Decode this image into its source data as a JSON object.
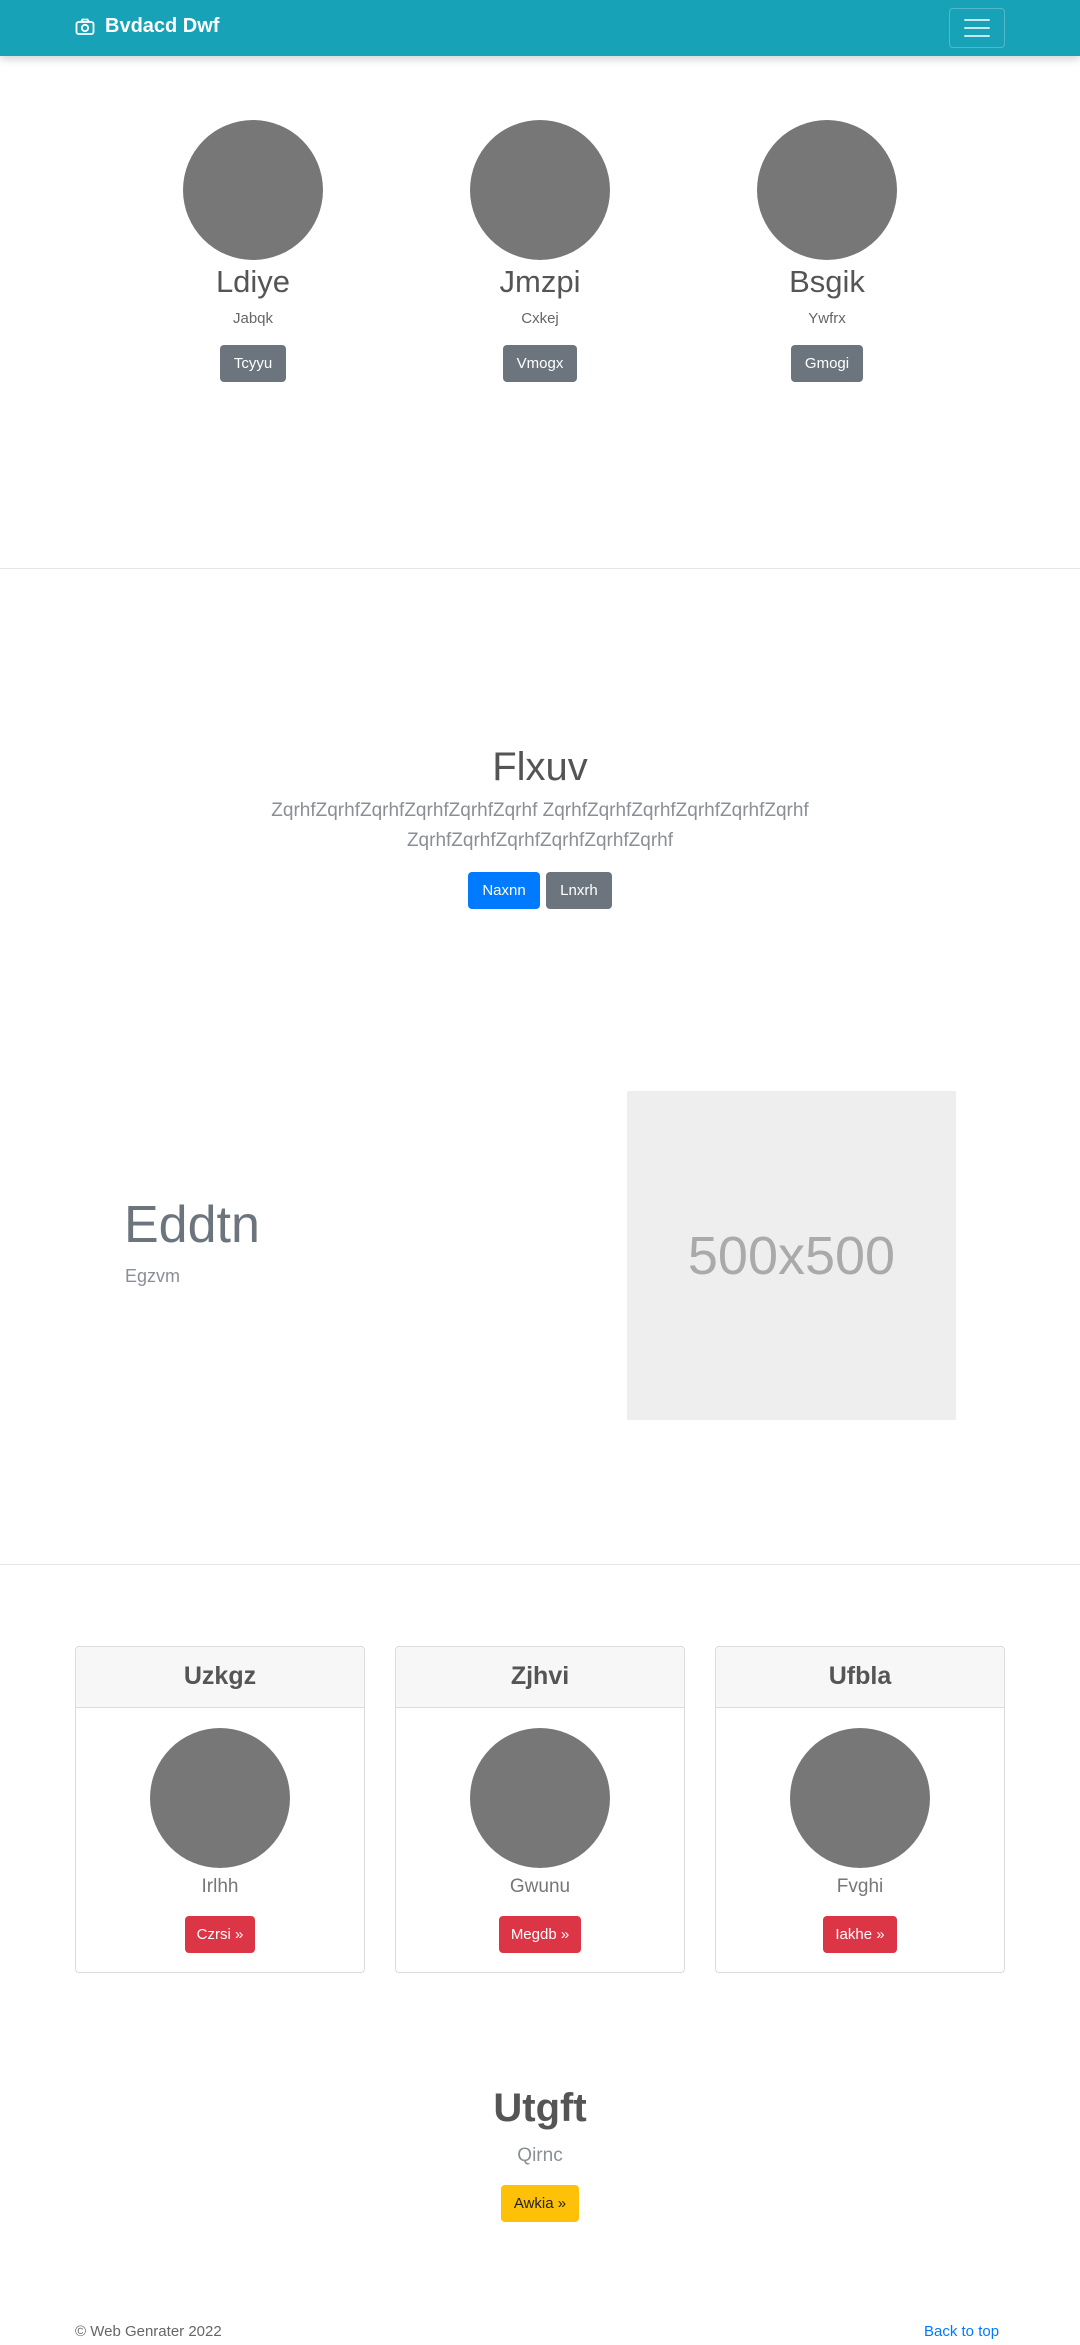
{
  "navbar": {
    "brand": "Bvdacd Dwf",
    "brand_icon": "camera-icon",
    "menu_icon": "hamburger-menu-icon",
    "color": "#17a2b8"
  },
  "people": [
    {
      "name": "Ldiye",
      "sub": "Jabqk",
      "button": "Tcyyu"
    },
    {
      "name": "Jmzpi",
      "sub": "Cxkej",
      "button": "Vmogx"
    },
    {
      "name": "Bsgik",
      "sub": "Ywfrx",
      "button": "Gmogi"
    }
  ],
  "hero": {
    "title": "Flxuv",
    "lead_line1": "ZqrhfZqrhfZqrhfZqrhfZqrhfZqrhf ZqrhfZqrhfZqrhfZqrhfZqrhfZqrhf",
    "lead_line2": "ZqrhfZqrhfZqrhfZqrhfZqrhfZqrhf",
    "primary_button": "Naxnn",
    "secondary_button": "Lnxrh"
  },
  "feature": {
    "title": "Eddtn",
    "subtitle": "Egzvm",
    "placeholder_text": "500x500"
  },
  "cards": [
    {
      "header": "Uzkgz",
      "name": "Irlhh",
      "button": "Czrsi »"
    },
    {
      "header": "Zjhvi",
      "name": "Gwunu",
      "button": "Megdb »"
    },
    {
      "header": "Ufbla",
      "name": "Fvghi",
      "button": "Iakhe »"
    }
  ],
  "cta": {
    "title": "Utgft",
    "subtitle": "Qirnc",
    "button": "Awkia »"
  },
  "footer": {
    "copyright": "© Web Genrater 2022",
    "back_to_top": "Back to top"
  }
}
